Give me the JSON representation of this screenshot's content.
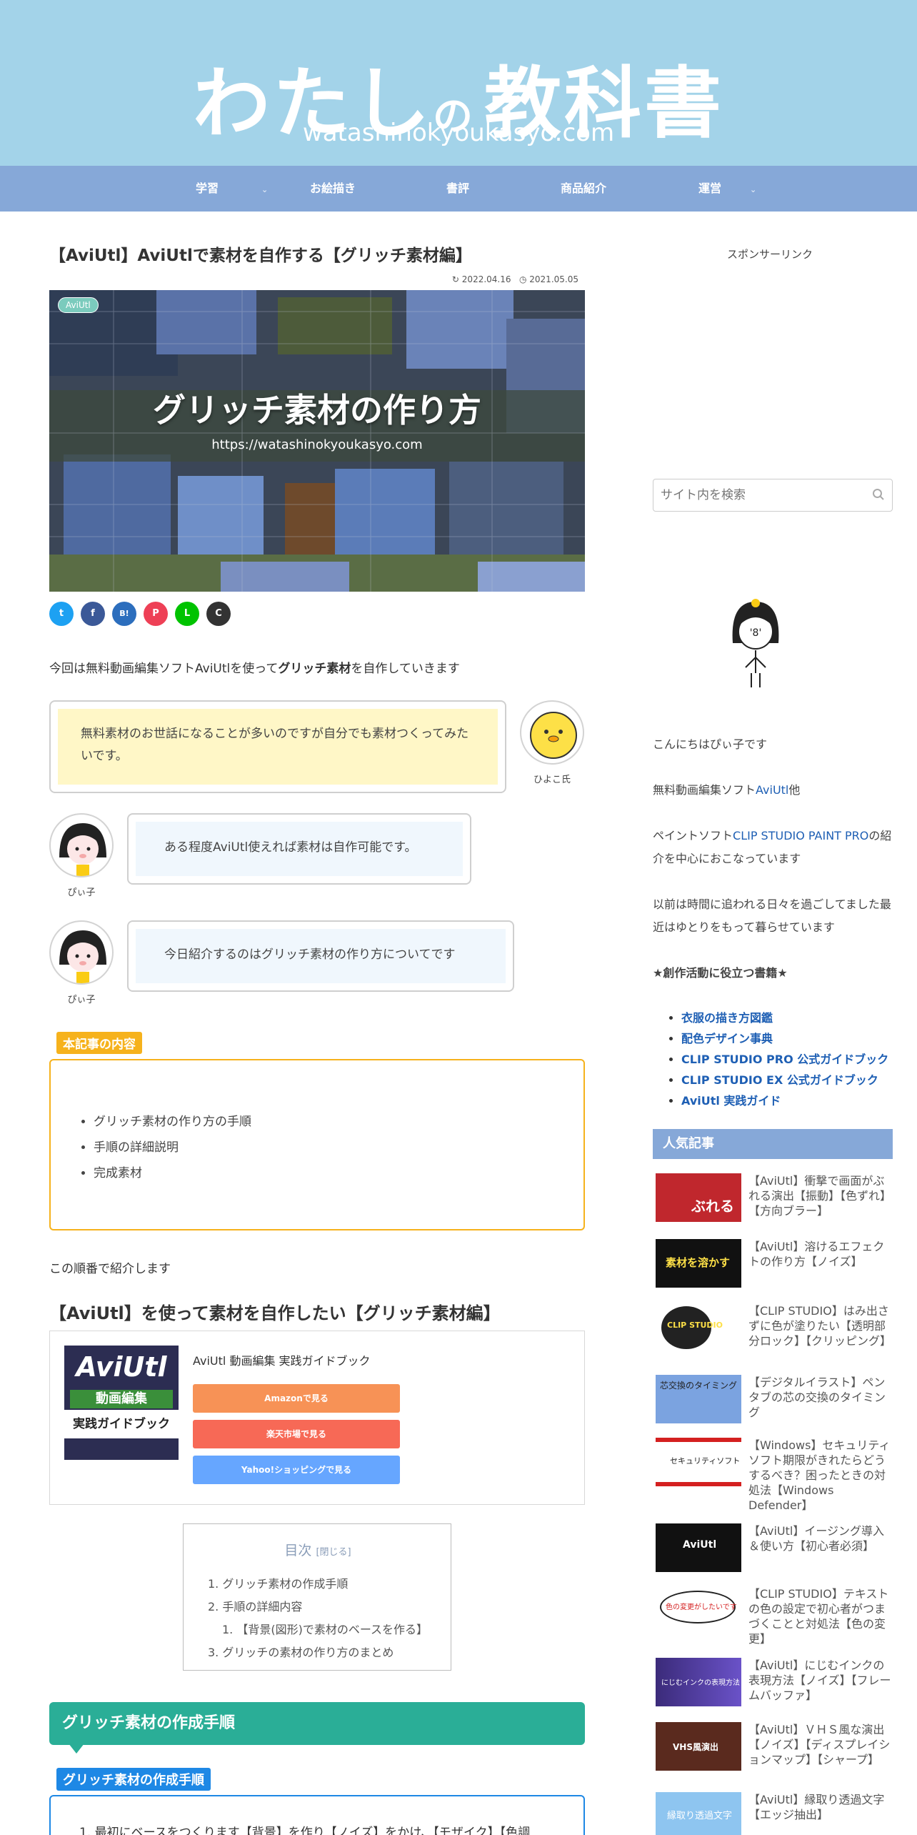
{
  "header": {
    "logo_part1": "わたし",
    "logo_part2": "の",
    "logo_part3": "教科書",
    "subtitle": "watashinokyoukasyo.com"
  },
  "nav": {
    "items": [
      {
        "label": "学習",
        "caret": "⌄"
      },
      {
        "label": "お絵描き",
        "caret": ""
      },
      {
        "label": "書評",
        "caret": ""
      },
      {
        "label": "商品紹介",
        "caret": ""
      },
      {
        "label": "運営",
        "caret": "⌄"
      }
    ]
  },
  "post": {
    "title": "【AviUtl】AviUtlで素材を自作する【グリッチ素材編】",
    "updated": "2022.04.16",
    "published": "2021.05.05",
    "category": "AviUtl",
    "eyecatch_title": "グリッチ素材の作り方",
    "eyecatch_url": "https://watashinokyoukasyo.com",
    "share": [
      "t",
      "f",
      "B!",
      "P",
      "L",
      "C"
    ],
    "intro_pre": "今回は無料動画編集ソフトAviUtlを使って",
    "intro_bold": "グリッチ素材",
    "intro_post": "を自作していきます",
    "balloons": [
      {
        "text": "無料素材のお世話になることが多いのですが自分でも素材つくってみたいです。",
        "name": "ひよこ氏"
      },
      {
        "text": "ある程度AviUtl使えれば素材は自作可能です。",
        "name": "ぴぃ子"
      },
      {
        "text": "今日紹介するのはグリッチ素材の作り方についてです",
        "name": "ぴぃ子"
      }
    ],
    "points_label": "本記事の内容",
    "points": [
      "グリッチ素材の作り方の手順",
      "手順の詳細説明",
      "完成素材"
    ],
    "order_text": "この順番で紹介します",
    "h2": "【AviUtl】を使って素材を自作したい【グリッチ素材編】",
    "product": {
      "cover_title": "AviUtl",
      "cover_sub1": "動画編集",
      "cover_sub2": "実践ガイドブック",
      "title": "AviUtl 動画編集 実践ガイドブック",
      "buttons": [
        "Amazonで見る",
        "楽天市場で見る",
        "Yahoo!ショッピングで見る"
      ]
    },
    "toc": {
      "title": "目次",
      "toggle": "[閉じる]",
      "items": [
        "1. グリッチ素材の作成手順",
        "2. 手順の詳細内容",
        "1. 【背景(図形)で素材のベースを作る】",
        "3. グリッチの素材の作り方のまとめ"
      ]
    },
    "section_head": "グリッチ素材の作成手順",
    "step_label": "グリッチ素材の作成手順",
    "step_text": "1. 最初にベースをつくります【背景】を作り【ノイズ】をかけ、【モザイク】【色調"
  },
  "sidebar": {
    "sponsor": "スポンサーリンク",
    "search_placeholder": "サイト内を検索",
    "profile_hello": "こんにちはぴぃ子です",
    "profile_line2_pre": "無料動画編集ソフト",
    "profile_line2_link": "AviUtl",
    "profile_line2_post": "他",
    "profile_line3_pre": "ペイントソフト",
    "profile_line3_link": "CLIP STUDIO PAINT PRO",
    "profile_line3_post": "の紹介を中心におこなっています",
    "profile_line4": "以前は時間に追われる日々を過ごしてました最近はゆとりをもって暮らせています",
    "books_heading": "★創作活動に役立つ書籍★",
    "books": [
      "衣服の描き方図鑑",
      "配色デザイン事典",
      "CLIP STUDIO PRO 公式ガイドブック",
      "CLIP STUDIO EX 公式ガイドブック",
      "AviUtl 実践ガイド"
    ],
    "popular_heading": "人気記事",
    "popular": [
      {
        "title": "【AviUtl】衝撃で画面がぶれる演出【振動】【色ずれ】【方向ブラー】",
        "thumb": "ぶれる"
      },
      {
        "title": "【AviUtl】溶けるエフェクトの作り方【ノイズ】",
        "thumb": "素材を溶かす"
      },
      {
        "title": "【CLIP STUDIO】はみ出さずに色が塗りたい【透明部分ロック】【クリッピング】",
        "thumb": "CLIP STUDIO"
      },
      {
        "title": "【デジタルイラスト】ペンタブの芯の交換のタイミング",
        "thumb": "芯交換のタイミング"
      },
      {
        "title": "【Windows】セキュリティソフト期限がきれたらどうするべき？困ったときの対処法【Windows Defender】",
        "thumb": "セキュリティソフト"
      },
      {
        "title": "【AviUtl】イージング導入＆使い方【初心者必須】",
        "thumb": "AviUtl"
      },
      {
        "title": "【CLIP STUDIO】テキストの色の設定で初心者がつまづくことと対処法【色の変更】",
        "thumb": "色の変更がしたいです"
      },
      {
        "title": "【AviUtl】にじむインクの表現方法【ノイズ】【フレームバッファ】",
        "thumb": "にじむインクの表現方法"
      },
      {
        "title": "【AviUtl】ＶＨＳ風な演出【ノイズ】【ディスプレイションマップ】【シャープ】",
        "thumb": "VHS風演出"
      },
      {
        "title": "【AviUtl】縁取り透過文字【エッジ抽出】",
        "thumb": "縁取り透過文字"
      }
    ]
  }
}
